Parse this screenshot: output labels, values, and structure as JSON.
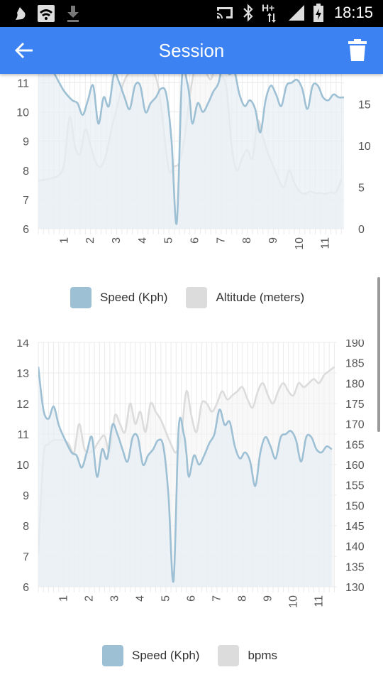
{
  "status_bar": {
    "time": "18:15",
    "network_label": "H+",
    "left_icons": [
      "app-notification-icon",
      "wifi-icon",
      "download-icon"
    ],
    "right_icons": [
      "cast-icon",
      "bluetooth-icon",
      "signal-icon",
      "battery-icon"
    ]
  },
  "app_bar": {
    "title": "Session",
    "back_icon": "arrow-back-icon",
    "delete_icon": "trash-icon",
    "color": "#3d82f2"
  },
  "colors": {
    "speed": "#9ec0d4",
    "speed_fill": "#e8eff4",
    "secondary": "#dcdcdc",
    "secondary_fill": "#f4f4f4",
    "grid": "#ebebeb",
    "tick_text": "#555555"
  },
  "chart_data": [
    {
      "type": "line",
      "x_tick_labels": [
        "1",
        "2",
        "3",
        "4",
        "5",
        "6",
        "7",
        "8",
        "9",
        "10",
        "11"
      ],
      "left_axis": {
        "ticks": [
          "6",
          "7",
          "8",
          "9",
          "10",
          "11"
        ],
        "ylim": [
          6,
          11.4
        ]
      },
      "right_axis": {
        "ticks": [
          "0",
          "5",
          "10",
          "15"
        ],
        "ylim": [
          0,
          19
        ]
      },
      "series": [
        {
          "name": "Speed (Kph)",
          "axis": "left",
          "x": [
            0.0,
            0.3,
            0.5,
            0.8,
            1.0,
            1.3,
            1.5,
            1.7,
            1.9,
            2.1,
            2.3,
            2.5,
            2.7,
            2.9,
            3.1,
            3.3,
            3.5,
            3.7,
            3.9,
            4.1,
            4.3,
            4.5,
            4.7,
            4.9,
            5.1,
            5.3,
            5.5,
            5.7,
            5.8,
            5.9,
            6.1,
            6.3,
            6.5,
            6.7,
            6.9,
            7.1,
            7.3,
            7.5,
            7.7,
            7.9,
            8.1,
            8.3,
            8.5,
            8.7,
            8.9,
            9.1,
            9.3,
            9.5,
            9.7,
            9.9,
            10.1,
            10.3,
            10.5,
            10.7,
            10.9,
            11.1,
            11.3,
            11.5,
            11.7
          ],
          "values": [
            11.9,
            11.7,
            11.5,
            11.0,
            10.7,
            10.4,
            10.3,
            9.9,
            10.4,
            10.9,
            9.6,
            10.5,
            10.2,
            11.3,
            11.0,
            10.5,
            10.1,
            10.9,
            10.9,
            10.0,
            10.3,
            10.5,
            10.8,
            10.6,
            9.0,
            6.2,
            11.2,
            11.0,
            10.4,
            9.6,
            10.3,
            10.0,
            10.3,
            10.7,
            11.0,
            11.8,
            11.3,
            11.4,
            10.6,
            10.2,
            10.4,
            10.1,
            9.3,
            10.4,
            10.9,
            10.6,
            10.2,
            10.9,
            11.0,
            11.1,
            10.8,
            10.1,
            10.9,
            10.9,
            10.5,
            10.4,
            10.6,
            10.5,
            10.5
          ],
          "color": "#9ec0d4"
        },
        {
          "name": "Altitude (meters)",
          "axis": "right",
          "x": [
            0.0,
            0.4,
            0.8,
            1.0,
            1.2,
            1.4,
            1.6,
            1.8,
            2.0,
            2.2,
            2.4,
            2.6,
            2.8,
            3.0,
            3.2,
            3.4,
            3.6,
            3.8,
            4.0,
            4.2,
            4.4,
            4.6,
            4.8,
            5.0,
            5.2,
            5.4,
            5.6,
            5.8,
            6.0,
            6.2,
            6.4,
            6.6,
            6.8,
            7.0,
            7.2,
            7.4,
            7.6,
            7.8,
            8.0,
            8.2,
            8.4,
            8.6,
            8.8,
            9.0,
            9.2,
            9.4,
            9.6,
            9.8,
            10.0,
            10.2,
            10.4,
            10.6,
            10.8,
            11.0,
            11.2,
            11.4,
            11.6
          ],
          "values": [
            5.8,
            6.0,
            6.5,
            8.0,
            13.5,
            10.0,
            9.0,
            12.0,
            10.0,
            8.0,
            7.5,
            9.0,
            12.0,
            14.5,
            17.0,
            18.5,
            19.0,
            19.5,
            21.0,
            20.0,
            19.0,
            17.0,
            12.0,
            7.0,
            7.5,
            8.0,
            11.0,
            16.0,
            19.5,
            20.0,
            19.0,
            18.0,
            19.5,
            18.5,
            17.0,
            10.0,
            7.0,
            8.5,
            9.5,
            8.5,
            13.0,
            11.0,
            9.0,
            7.5,
            6.0,
            5.0,
            7.0,
            5.5,
            4.5,
            4.2,
            4.5,
            4.3,
            4.3,
            4.2,
            4.4,
            4.4,
            6.0
          ],
          "color": "#dcdcdc"
        }
      ]
    },
    {
      "type": "line",
      "x_tick_labels": [
        "1",
        "2",
        "3",
        "4",
        "5",
        "6",
        "7",
        "8",
        "9",
        "10",
        "11"
      ],
      "left_axis": {
        "ticks": [
          "6",
          "7",
          "8",
          "9",
          "10",
          "11",
          "12",
          "13",
          "14"
        ],
        "ylim": [
          6,
          14
        ]
      },
      "right_axis": {
        "ticks": [
          "130",
          "135",
          "140",
          "145",
          "150",
          "155",
          "160",
          "165",
          "170",
          "175",
          "180",
          "185",
          "190"
        ],
        "ylim": [
          130,
          190
        ]
      },
      "series": [
        {
          "name": "Speed (Kph)",
          "axis": "left",
          "x": [
            0.0,
            0.2,
            0.4,
            0.6,
            0.8,
            1.0,
            1.3,
            1.5,
            1.7,
            1.9,
            2.1,
            2.3,
            2.5,
            2.7,
            2.9,
            3.1,
            3.3,
            3.5,
            3.7,
            3.9,
            4.1,
            4.3,
            4.5,
            4.7,
            4.9,
            5.1,
            5.3,
            5.5,
            5.7,
            5.8,
            5.9,
            6.1,
            6.3,
            6.5,
            6.7,
            6.9,
            7.1,
            7.3,
            7.5,
            7.7,
            7.9,
            8.1,
            8.3,
            8.5,
            8.7,
            8.9,
            9.1,
            9.3,
            9.5,
            9.7,
            9.9,
            10.1,
            10.3,
            10.5,
            10.7,
            10.9,
            11.1,
            11.3,
            11.5
          ],
          "values": [
            13.2,
            11.8,
            11.5,
            11.9,
            11.3,
            10.9,
            10.4,
            10.3,
            9.9,
            10.4,
            10.9,
            9.6,
            10.5,
            10.2,
            11.3,
            11.0,
            10.5,
            10.1,
            10.9,
            10.9,
            10.0,
            10.3,
            10.5,
            10.8,
            10.6,
            9.0,
            6.2,
            11.2,
            11.0,
            10.4,
            9.6,
            10.3,
            10.0,
            10.3,
            10.7,
            11.0,
            11.8,
            11.3,
            11.4,
            10.6,
            10.2,
            10.4,
            10.1,
            9.3,
            10.4,
            10.9,
            10.6,
            10.2,
            10.9,
            11.0,
            11.1,
            10.8,
            10.1,
            10.9,
            10.9,
            10.5,
            10.4,
            10.6,
            10.5
          ],
          "color": "#9ec0d4"
        },
        {
          "name": "bpms",
          "axis": "right",
          "x": [
            0.0,
            0.2,
            0.4,
            0.6,
            0.8,
            1.0,
            1.2,
            1.4,
            1.6,
            1.8,
            2.0,
            2.2,
            2.4,
            2.6,
            2.8,
            3.0,
            3.2,
            3.4,
            3.6,
            3.8,
            4.0,
            4.2,
            4.4,
            4.6,
            4.8,
            5.0,
            5.2,
            5.4,
            5.6,
            5.8,
            6.0,
            6.2,
            6.4,
            6.6,
            6.8,
            7.0,
            7.2,
            7.4,
            7.6,
            7.8,
            8.0,
            8.2,
            8.4,
            8.6,
            8.8,
            9.0,
            9.2,
            9.4,
            9.6,
            9.8,
            10.0,
            10.2,
            10.4,
            10.6,
            10.8,
            11.0,
            11.2,
            11.4,
            11.6
          ],
          "values": [
            138,
            162,
            165,
            166,
            166,
            166,
            165,
            163,
            170,
            164,
            163,
            164,
            166,
            167,
            163,
            172,
            170,
            168,
            175,
            170,
            173,
            168,
            175,
            173,
            171,
            168,
            165,
            163,
            167,
            178,
            172,
            168,
            175,
            175,
            173,
            175,
            178,
            176,
            177,
            178,
            179,
            176,
            174,
            178,
            180,
            177,
            175,
            178,
            180,
            178,
            177,
            180,
            179,
            180,
            181,
            180,
            182,
            183,
            184
          ],
          "color": "#dcdcdc"
        }
      ]
    }
  ],
  "legends": [
    {
      "items": [
        {
          "label": "Speed (Kph)",
          "color": "#9ec0d4"
        },
        {
          "label": "Altitude (meters)",
          "color": "#dcdcdc"
        }
      ]
    },
    {
      "items": [
        {
          "label": "Speed (Kph)",
          "color": "#9ec0d4"
        },
        {
          "label": "bpms",
          "color": "#dcdcdc"
        }
      ]
    }
  ]
}
